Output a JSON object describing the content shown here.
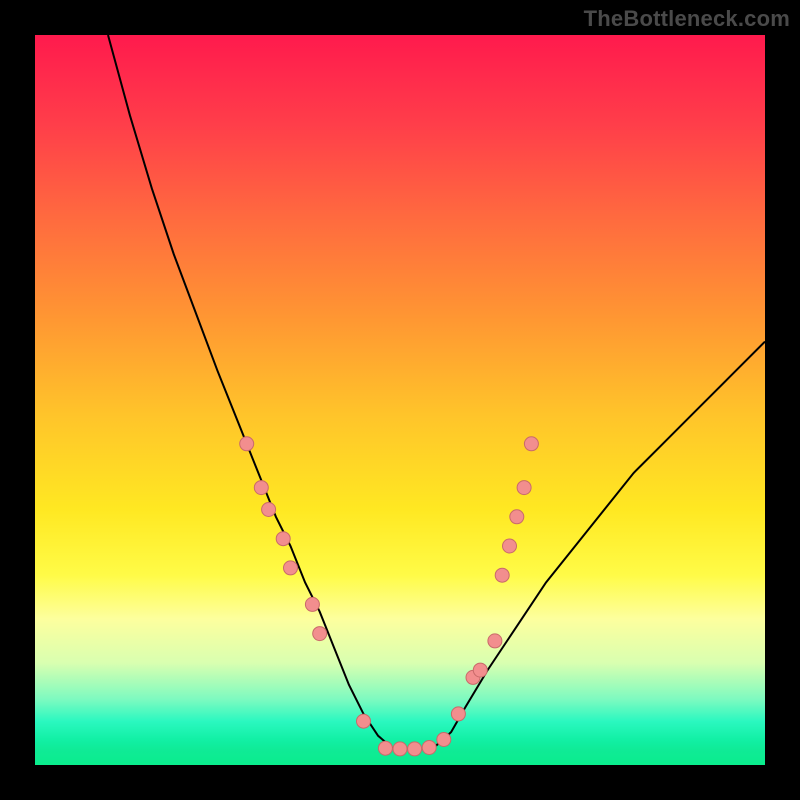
{
  "watermark": "TheBottleneck.com",
  "colors": {
    "curve_stroke": "#000000",
    "dot_fill": "#f28e8e",
    "dot_stroke": "#c96a6a"
  },
  "chart_data": {
    "type": "line",
    "title": "",
    "xlabel": "",
    "ylabel": "",
    "xlim": [
      0,
      100
    ],
    "ylim": [
      0,
      100
    ],
    "curve": {
      "x": [
        10,
        13,
        16,
        19,
        22,
        25,
        27,
        29,
        31,
        33,
        35,
        37,
        39,
        41,
        43,
        45,
        47,
        49,
        51,
        53,
        55,
        57,
        59,
        62,
        66,
        70,
        74,
        78,
        82,
        86,
        90,
        95,
        100
      ],
      "y": [
        100,
        89,
        79,
        70,
        62,
        54,
        49,
        44,
        39,
        34,
        30,
        25,
        21,
        16,
        11,
        7,
        4,
        2.3,
        2.2,
        2.2,
        2.7,
        4.5,
        8,
        13,
        19,
        25,
        30,
        35,
        40,
        44,
        48,
        53,
        58
      ]
    },
    "series": [
      {
        "name": "dots",
        "points": [
          {
            "x": 29,
            "y": 44
          },
          {
            "x": 31,
            "y": 38
          },
          {
            "x": 32,
            "y": 35
          },
          {
            "x": 34,
            "y": 31
          },
          {
            "x": 35,
            "y": 27
          },
          {
            "x": 38,
            "y": 22
          },
          {
            "x": 39,
            "y": 18
          },
          {
            "x": 45,
            "y": 6
          },
          {
            "x": 48,
            "y": 2.3
          },
          {
            "x": 50,
            "y": 2.2
          },
          {
            "x": 52,
            "y": 2.2
          },
          {
            "x": 54,
            "y": 2.4
          },
          {
            "x": 56,
            "y": 3.5
          },
          {
            "x": 58,
            "y": 7
          },
          {
            "x": 60,
            "y": 12
          },
          {
            "x": 61,
            "y": 13
          },
          {
            "x": 63,
            "y": 17
          },
          {
            "x": 64,
            "y": 26
          },
          {
            "x": 65,
            "y": 30
          },
          {
            "x": 66,
            "y": 34
          },
          {
            "x": 67,
            "y": 38
          },
          {
            "x": 68,
            "y": 44
          }
        ]
      }
    ]
  }
}
